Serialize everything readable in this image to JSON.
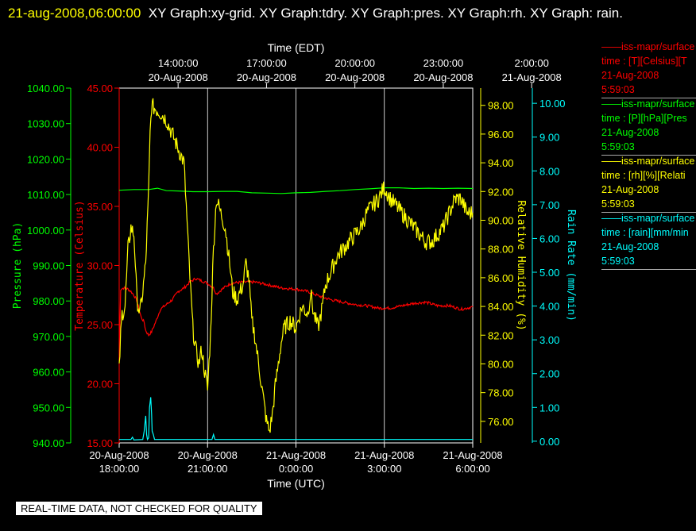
{
  "title": {
    "timestamp": "21-aug-2008,06:00:00",
    "text": "XY Graph:xy-grid.  XY Graph:tdry.  XY Graph:pres.  XY Graph:rh.  XY Graph: rain."
  },
  "footer": "REAL-TIME DATA, NOT CHECKED FOR QUALITY",
  "legend": [
    {
      "line": "——iss-mapr/surface",
      "desc": "time : [T][Celsius][T",
      "date": "21-Aug-2008",
      "time": "5:59:03",
      "color": "#ff0000"
    },
    {
      "line": "——iss-mapr/surface",
      "desc": "time : [P][hPa][Pres",
      "date": "21-Aug-2008",
      "time": "5:59:03",
      "color": "#00ff00"
    },
    {
      "line": "——iss-mapr/surface",
      "desc": "time : [rh][%][Relati",
      "date": "21-Aug-2008",
      "time": "5:59:03",
      "color": "#ffff00"
    },
    {
      "line": "——iss-mapr/surface",
      "desc": "time : [rain][mm/min",
      "date": "21-Aug-2008",
      "time": "5:59:03",
      "color": "#00ffff"
    }
  ],
  "chart_data": {
    "type": "line",
    "x_top": {
      "label": "Time (EDT)",
      "ticks": [
        {
          "h": 2,
          "t1": "14:00:00",
          "t2": "20-Aug-2008"
        },
        {
          "h": 5,
          "t1": "17:00:00",
          "t2": "20-Aug-2008"
        },
        {
          "h": 8,
          "t1": "20:00:00",
          "t2": "20-Aug-2008"
        },
        {
          "h": 11,
          "t1": "23:00:00",
          "t2": "20-Aug-2008"
        },
        {
          "h": 14,
          "t1": "2:00:00",
          "t2": "21-Aug-2008"
        }
      ]
    },
    "x_bottom": {
      "label": "Time (UTC)",
      "range_hours": [
        0,
        12
      ],
      "ticks": [
        {
          "h": 0,
          "t1": "20-Aug-2008",
          "t2": "18:00:00"
        },
        {
          "h": 3,
          "t1": "20-Aug-2008",
          "t2": "21:00:00"
        },
        {
          "h": 6,
          "t1": "21-Aug-2008",
          "t2": "0:00:00"
        },
        {
          "h": 9,
          "t1": "21-Aug-2008",
          "t2": "3:00:00"
        },
        {
          "h": 12,
          "t1": "21-Aug-2008",
          "t2": "6:00:00"
        }
      ]
    },
    "grid_vertical_hours": [
      3,
      6,
      9
    ],
    "axes": {
      "pressure": {
        "label": "Pressure (hPa)",
        "color": "#00ff00",
        "range": [
          940,
          1040
        ],
        "ticks": [
          "940.00",
          "950.00",
          "960.00",
          "970.00",
          "980.00",
          "990.00",
          "1000.00",
          "1010.00",
          "1020.00",
          "1030.00",
          "1040.00"
        ]
      },
      "temperature": {
        "label": "Temperature (Celsius)",
        "color": "#ff0000",
        "range": [
          15,
          45
        ],
        "ticks": [
          "15.00",
          "20.00",
          "25.00",
          "30.00",
          "35.00",
          "40.00",
          "45.00"
        ]
      },
      "humidity": {
        "label": "Relative Humidity (%)",
        "color": "#ffff00",
        "range": [
          74.5,
          99.2
        ],
        "ticks": [
          "76.00",
          "78.00",
          "80.00",
          "82.00",
          "84.00",
          "86.00",
          "88.00",
          "90.00",
          "92.00",
          "94.00",
          "96.00",
          "98.00"
        ]
      },
      "rain": {
        "label": "Rain Rate (mm/min)",
        "color": "#00ffff",
        "range": [
          -0.05,
          10.45
        ],
        "ticks": [
          "0.00",
          "1.00",
          "2.00",
          "3.00",
          "4.00",
          "5.00",
          "6.00",
          "7.00",
          "8.00",
          "9.00",
          "10.00"
        ]
      }
    },
    "series": [
      {
        "name": "iss-mapr/surface T",
        "axis": "temperature",
        "color": "#ff0000",
        "points": [
          [
            0,
            22
          ],
          [
            0.05,
            28
          ],
          [
            0.15,
            28.1
          ],
          [
            0.3,
            28
          ],
          [
            0.4,
            27.8
          ],
          [
            0.5,
            27.5
          ],
          [
            0.6,
            27
          ],
          [
            0.75,
            25.6
          ],
          [
            0.85,
            25.2
          ],
          [
            0.9,
            24.5
          ],
          [
            1.0,
            24.1
          ],
          [
            1.1,
            24.4
          ],
          [
            1.25,
            25.3
          ],
          [
            1.4,
            26.3
          ],
          [
            1.6,
            26.7
          ],
          [
            1.8,
            27.1
          ],
          [
            2.0,
            27.8
          ],
          [
            2.2,
            28.1
          ],
          [
            2.4,
            28.6
          ],
          [
            2.6,
            28.9
          ],
          [
            2.8,
            28.7
          ],
          [
            3.0,
            28.5
          ],
          [
            3.2,
            28.1
          ],
          [
            3.3,
            27.6
          ],
          [
            3.45,
            27.9
          ],
          [
            3.6,
            28.2
          ],
          [
            3.8,
            28.5
          ],
          [
            4.2,
            28.6
          ],
          [
            4.6,
            28.6
          ],
          [
            5.0,
            28.4
          ],
          [
            5.5,
            28.1
          ],
          [
            6.0,
            28.0
          ],
          [
            6.4,
            27.8
          ],
          [
            6.8,
            27.4
          ],
          [
            7.2,
            27.1
          ],
          [
            7.6,
            26.9
          ],
          [
            8.0,
            26.7
          ],
          [
            8.4,
            26.6
          ],
          [
            8.8,
            26.4
          ],
          [
            9.2,
            26.4
          ],
          [
            9.6,
            26.6
          ],
          [
            10.0,
            26.8
          ],
          [
            10.4,
            26.9
          ],
          [
            10.8,
            26.6
          ],
          [
            11.2,
            26.6
          ],
          [
            11.6,
            26.3
          ],
          [
            12.0,
            26.5
          ]
        ]
      },
      {
        "name": "iss-mapr/surface P",
        "axis": "pressure",
        "color": "#00ff00",
        "points": [
          [
            0,
            1011.2
          ],
          [
            0.5,
            1011.4
          ],
          [
            1.0,
            1011.4
          ],
          [
            1.3,
            1011.8
          ],
          [
            1.6,
            1011.1
          ],
          [
            2.0,
            1011.0
          ],
          [
            2.5,
            1010.8
          ],
          [
            3.0,
            1010.8
          ],
          [
            3.5,
            1010.9
          ],
          [
            4.0,
            1010.9
          ],
          [
            4.5,
            1010.5
          ],
          [
            5.0,
            1010.4
          ],
          [
            5.5,
            1010.3
          ],
          [
            6.0,
            1010.5
          ],
          [
            6.5,
            1010.6
          ],
          [
            7.0,
            1010.9
          ],
          [
            7.5,
            1011.1
          ],
          [
            8.0,
            1011.4
          ],
          [
            8.5,
            1011.6
          ],
          [
            9.0,
            1011.9
          ],
          [
            9.5,
            1011.9
          ],
          [
            10.0,
            1011.7
          ],
          [
            10.5,
            1011.8
          ],
          [
            11.0,
            1011.7
          ],
          [
            11.5,
            1011.8
          ],
          [
            12.0,
            1011.7
          ]
        ]
      },
      {
        "name": "iss-mapr/surface rh",
        "axis": "humidity",
        "color": "#ffff00",
        "points": [
          [
            0,
            79.5
          ],
          [
            0.05,
            82.0
          ],
          [
            0.1,
            83.5
          ],
          [
            0.2,
            84.0
          ],
          [
            0.3,
            88.0
          ],
          [
            0.4,
            89.5
          ],
          [
            0.5,
            89.0
          ],
          [
            0.55,
            87.0
          ],
          [
            0.6,
            84.5
          ],
          [
            0.7,
            83.5
          ],
          [
            0.8,
            85.0
          ],
          [
            0.9,
            87.0
          ],
          [
            1.0,
            92.0
          ],
          [
            1.05,
            96.0
          ],
          [
            1.1,
            98.0
          ],
          [
            1.2,
            97.8
          ],
          [
            1.4,
            97.5
          ],
          [
            1.6,
            97.0
          ],
          [
            1.8,
            96.0
          ],
          [
            2.0,
            95.0
          ],
          [
            2.2,
            94.0
          ],
          [
            2.3,
            90.0
          ],
          [
            2.4,
            86.0
          ],
          [
            2.5,
            82.5
          ],
          [
            2.6,
            81.0
          ],
          [
            2.7,
            80.0
          ],
          [
            2.8,
            81.0
          ],
          [
            2.9,
            79.5
          ],
          [
            3.0,
            78.2
          ],
          [
            3.1,
            82.0
          ],
          [
            3.2,
            88.0
          ],
          [
            3.3,
            91.5
          ],
          [
            3.45,
            90.5
          ],
          [
            3.6,
            89.5
          ],
          [
            3.75,
            87.0
          ],
          [
            3.85,
            85.0
          ],
          [
            4.0,
            84.5
          ],
          [
            4.2,
            85.5
          ],
          [
            4.3,
            87.0
          ],
          [
            4.4,
            86.0
          ],
          [
            4.5,
            83.0
          ],
          [
            4.6,
            82.0
          ],
          [
            4.7,
            80.5
          ],
          [
            4.8,
            79.0
          ],
          [
            4.9,
            77.5
          ],
          [
            5.0,
            76.0
          ],
          [
            5.1,
            75.3
          ],
          [
            5.2,
            76.5
          ],
          [
            5.3,
            78.5
          ],
          [
            5.4,
            80.0
          ],
          [
            5.5,
            81.5
          ],
          [
            5.6,
            82.5
          ],
          [
            5.8,
            83.0
          ],
          [
            6.0,
            82.5
          ],
          [
            6.2,
            84.0
          ],
          [
            6.4,
            83.5
          ],
          [
            6.5,
            85.0
          ],
          [
            6.6,
            83.5
          ],
          [
            6.75,
            82.5
          ],
          [
            6.9,
            84.0
          ],
          [
            7.0,
            85.5
          ],
          [
            7.2,
            86.5
          ],
          [
            7.4,
            87.5
          ],
          [
            7.6,
            88.0
          ],
          [
            7.8,
            88.5
          ],
          [
            8.0,
            89.0
          ],
          [
            8.2,
            89.5
          ],
          [
            8.4,
            90.5
          ],
          [
            8.6,
            91.0
          ],
          [
            8.8,
            91.5
          ],
          [
            9.0,
            92.3
          ],
          [
            9.2,
            91.5
          ],
          [
            9.4,
            91.0
          ],
          [
            9.6,
            90.5
          ],
          [
            9.8,
            90.0
          ],
          [
            10.0,
            89.5
          ],
          [
            10.2,
            89.0
          ],
          [
            10.4,
            88.5
          ],
          [
            10.6,
            88.5
          ],
          [
            10.8,
            89.0
          ],
          [
            11.0,
            89.5
          ],
          [
            11.2,
            90.5
          ],
          [
            11.4,
            91.5
          ],
          [
            11.6,
            91.5
          ],
          [
            11.8,
            90.5
          ],
          [
            12.0,
            90.5
          ]
        ]
      },
      {
        "name": "iss-mapr/surface rain",
        "axis": "rain",
        "color": "#00ffff",
        "points": [
          [
            0,
            0.05
          ],
          [
            0.4,
            0.05
          ],
          [
            0.45,
            0.12
          ],
          [
            0.5,
            0.04
          ],
          [
            0.8,
            0.05
          ],
          [
            0.85,
            0.3
          ],
          [
            0.9,
            0.75
          ],
          [
            0.93,
            0.2
          ],
          [
            0.96,
            0.05
          ],
          [
            1.0,
            0.1
          ],
          [
            1.03,
            1.0
          ],
          [
            1.07,
            1.3
          ],
          [
            1.1,
            0.8
          ],
          [
            1.12,
            0.3
          ],
          [
            1.16,
            0.2
          ],
          [
            1.2,
            0.05
          ],
          [
            3.15,
            0.05
          ],
          [
            3.2,
            0.2
          ],
          [
            3.25,
            0.05
          ],
          [
            12.0,
            0.05
          ]
        ]
      }
    ]
  }
}
